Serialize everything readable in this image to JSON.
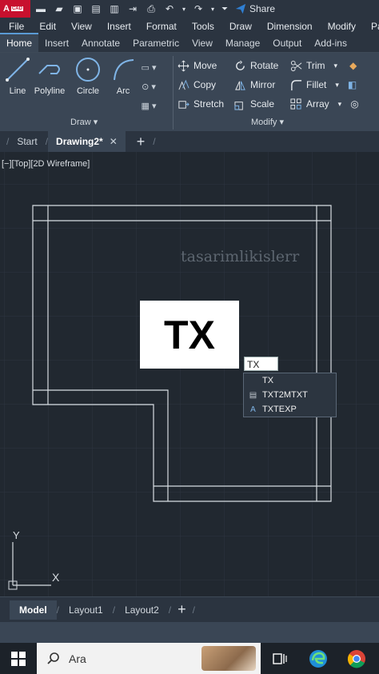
{
  "app": {
    "logo_letter": "A",
    "logo_badge": "CAD",
    "share_label": "Share"
  },
  "menu": [
    "File",
    "Edit",
    "View",
    "Insert",
    "Format",
    "Tools",
    "Draw",
    "Dimension",
    "Modify",
    "Pa"
  ],
  "ribbon_tabs": [
    "Home",
    "Insert",
    "Annotate",
    "Parametric",
    "View",
    "Manage",
    "Output",
    "Add-ins"
  ],
  "draw_panel": {
    "title": "Draw",
    "tools": [
      "Line",
      "Polyline",
      "Circle",
      "Arc"
    ]
  },
  "modify_panel": {
    "title": "Modify",
    "rows": [
      [
        "Move",
        "Rotate",
        "Trim"
      ],
      [
        "Copy",
        "Mirror",
        "Fillet"
      ],
      [
        "Stretch",
        "Scale",
        "Array"
      ]
    ]
  },
  "file_tabs": {
    "start": "Start",
    "active": "Drawing2*"
  },
  "viewport_label": "[−][Top][2D Wireframe]",
  "watermark": "tasarimlikislerr",
  "overlay_text": "TX",
  "command": {
    "input_value": "TX",
    "suggestions": [
      "TX",
      "TXT2MTXT",
      "TXTEXP"
    ]
  },
  "ucs": {
    "x_label": "X",
    "y_label": "Y"
  },
  "layout_tabs": [
    "Model",
    "Layout1",
    "Layout2"
  ],
  "taskbar": {
    "search_placeholder": "Ara"
  },
  "colors": {
    "canvas_bg": "#212830",
    "ribbon_bg": "#3a4655",
    "accent": "#c8102e",
    "share_blue": "#2f7fd3"
  }
}
